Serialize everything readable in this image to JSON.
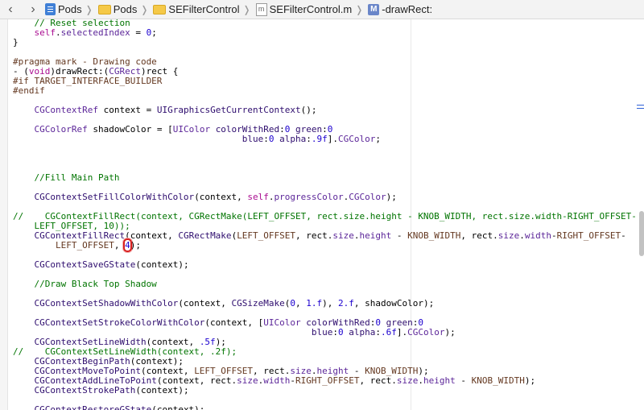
{
  "jumpbar": {
    "back_icon": "chevron-left-icon",
    "forward_icon": "chevron-right-icon",
    "crumbs": [
      "Pods",
      "Pods",
      "SEFilterControl",
      "SEFilterControl.m",
      "-drawRect:"
    ],
    "crumb_icons": [
      "project-doc-icon",
      "folder-icon",
      "folder-icon",
      "objc-file-icon",
      "method-icon"
    ],
    "file_icon_letter": "m",
    "method_icon_letter": "M"
  },
  "code_lines": [
    [
      [
        "cm",
        "    // Reset selection"
      ]
    ],
    [
      [
        "t",
        "    "
      ],
      [
        "kw",
        "self"
      ],
      [
        "t",
        "."
      ],
      [
        "ty",
        "selectedIndex"
      ],
      [
        "t",
        " = "
      ],
      [
        "nm",
        "0"
      ],
      [
        "t",
        ";"
      ]
    ],
    [
      [
        "t",
        "}"
      ]
    ],
    [
      [
        "t",
        ""
      ]
    ],
    [
      [
        "pp",
        "#pragma mark - Drawing code"
      ]
    ],
    [
      [
        "t",
        "- ("
      ],
      [
        "kw",
        "void"
      ],
      [
        "t",
        ")drawRect:("
      ],
      [
        "ty",
        "CGRect"
      ],
      [
        "t",
        ")rect {"
      ]
    ],
    [
      [
        "pp",
        "#if TARGET_INTERFACE_BUILDER"
      ]
    ],
    [
      [
        "pp",
        "#endif"
      ]
    ],
    [
      [
        "t",
        ""
      ]
    ],
    [
      [
        "t",
        "    "
      ],
      [
        "ty",
        "CGContextRef"
      ],
      [
        "t",
        " context = "
      ],
      [
        "fn",
        "UIGraphicsGetCurrentContext"
      ],
      [
        "t",
        "();"
      ]
    ],
    [
      [
        "t",
        ""
      ]
    ],
    [
      [
        "t",
        "    "
      ],
      [
        "ty",
        "CGColorRef"
      ],
      [
        "t",
        " shadowColor = ["
      ],
      [
        "ty",
        "UIColor"
      ],
      [
        "t",
        " "
      ],
      [
        "fn",
        "colorWithRed"
      ],
      [
        "t",
        ":"
      ],
      [
        "nm",
        "0"
      ],
      [
        "t",
        " "
      ],
      [
        "fn",
        "green"
      ],
      [
        "t",
        ":"
      ],
      [
        "nm",
        "0"
      ]
    ],
    [
      [
        "t",
        "                                           "
      ],
      [
        "fn",
        "blue"
      ],
      [
        "t",
        ":"
      ],
      [
        "nm",
        "0"
      ],
      [
        "t",
        " "
      ],
      [
        "fn",
        "alpha"
      ],
      [
        "t",
        ":"
      ],
      [
        "nm",
        ".9f"
      ],
      [
        "t",
        "]."
      ],
      [
        "ty",
        "CGColor"
      ],
      [
        "t",
        ";"
      ]
    ],
    [
      [
        "t",
        ""
      ]
    ],
    [
      [
        "t",
        ""
      ]
    ],
    [
      [
        "t",
        ""
      ]
    ],
    [
      [
        "cm",
        "    //Fill Main Path"
      ]
    ],
    [
      [
        "t",
        ""
      ]
    ],
    [
      [
        "t",
        "    "
      ],
      [
        "fn",
        "CGContextSetFillColorWithColor"
      ],
      [
        "t",
        "(context, "
      ],
      [
        "kw",
        "self"
      ],
      [
        "t",
        "."
      ],
      [
        "ty",
        "progressColor"
      ],
      [
        "t",
        "."
      ],
      [
        "ty",
        "CGColor"
      ],
      [
        "t",
        ");"
      ]
    ],
    [
      [
        "t",
        ""
      ]
    ],
    [
      [
        "cm",
        "//    CGContextFillRect(context, CGRectMake(LEFT_OFFSET, rect.size.height - KNOB_WIDTH, rect.size.width-RIGHT_OFFSET-"
      ]
    ],
    [
      [
        "cm",
        "    LEFT_OFFSET, 10));"
      ]
    ],
    [
      [
        "t",
        "    "
      ],
      [
        "fn",
        "CGContextFillRect"
      ],
      [
        "t",
        "(context, "
      ],
      [
        "fn",
        "CGRectMake"
      ],
      [
        "t",
        "("
      ],
      [
        "mac",
        "LEFT_OFFSET"
      ],
      [
        "t",
        ", rect."
      ],
      [
        "ty",
        "size"
      ],
      [
        "t",
        "."
      ],
      [
        "ty",
        "height"
      ],
      [
        "t",
        " - "
      ],
      [
        "mac",
        "KNOB_WIDTH"
      ],
      [
        "t",
        ", rect."
      ],
      [
        "ty",
        "size"
      ],
      [
        "t",
        "."
      ],
      [
        "ty",
        "width"
      ],
      [
        "t",
        "-"
      ],
      [
        "mac",
        "RIGHT_OFFSET"
      ],
      [
        "t",
        "-"
      ]
    ],
    [
      [
        "t",
        "        "
      ],
      [
        "mac",
        "LEFT_OFFSET"
      ],
      [
        "t",
        ", "
      ],
      [
        "hl",
        "4"
      ],
      [
        "t",
        ");"
      ]
    ],
    [
      [
        "t",
        ""
      ]
    ],
    [
      [
        "t",
        "    "
      ],
      [
        "fn",
        "CGContextSaveGState"
      ],
      [
        "t",
        "(context);"
      ]
    ],
    [
      [
        "t",
        ""
      ]
    ],
    [
      [
        "cm",
        "    //Draw Black Top Shadow"
      ]
    ],
    [
      [
        "t",
        ""
      ]
    ],
    [
      [
        "t",
        "    "
      ],
      [
        "fn",
        "CGContextSetShadowWithColor"
      ],
      [
        "t",
        "(context, "
      ],
      [
        "fn",
        "CGSizeMake"
      ],
      [
        "t",
        "("
      ],
      [
        "nm",
        "0"
      ],
      [
        "t",
        ", "
      ],
      [
        "nm",
        "1.f"
      ],
      [
        "t",
        "), "
      ],
      [
        "nm",
        "2.f"
      ],
      [
        "t",
        ", shadowColor);"
      ]
    ],
    [
      [
        "t",
        ""
      ]
    ],
    [
      [
        "t",
        "    "
      ],
      [
        "fn",
        "CGContextSetStrokeColorWithColor"
      ],
      [
        "t",
        "(context, ["
      ],
      [
        "ty",
        "UIColor"
      ],
      [
        "t",
        " "
      ],
      [
        "fn",
        "colorWithRed"
      ],
      [
        "t",
        ":"
      ],
      [
        "nm",
        "0"
      ],
      [
        "t",
        " "
      ],
      [
        "fn",
        "green"
      ],
      [
        "t",
        ":"
      ],
      [
        "nm",
        "0"
      ]
    ],
    [
      [
        "t",
        "                                                        "
      ],
      [
        "fn",
        "blue"
      ],
      [
        "t",
        ":"
      ],
      [
        "nm",
        "0"
      ],
      [
        "t",
        " "
      ],
      [
        "fn",
        "alpha"
      ],
      [
        "t",
        ":"
      ],
      [
        "nm",
        ".6f"
      ],
      [
        "t",
        "]."
      ],
      [
        "ty",
        "CGColor"
      ],
      [
        "t",
        ");"
      ]
    ],
    [
      [
        "t",
        "    "
      ],
      [
        "fn",
        "CGContextSetLineWidth"
      ],
      [
        "t",
        "(context, "
      ],
      [
        "nm",
        ".5f"
      ],
      [
        "t",
        ");"
      ]
    ],
    [
      [
        "cm",
        "//    CGContextSetLineWidth(context, .2f);"
      ]
    ],
    [
      [
        "t",
        "    "
      ],
      [
        "fn",
        "CGContextBeginPath"
      ],
      [
        "t",
        "(context);"
      ]
    ],
    [
      [
        "t",
        "    "
      ],
      [
        "fn",
        "CGContextMoveToPoint"
      ],
      [
        "t",
        "(context, "
      ],
      [
        "mac",
        "LEFT_OFFSET"
      ],
      [
        "t",
        ", rect."
      ],
      [
        "ty",
        "size"
      ],
      [
        "t",
        "."
      ],
      [
        "ty",
        "height"
      ],
      [
        "t",
        " - "
      ],
      [
        "mac",
        "KNOB_WIDTH"
      ],
      [
        "t",
        ");"
      ]
    ],
    [
      [
        "t",
        "    "
      ],
      [
        "fn",
        "CGContextAddLineToPoint"
      ],
      [
        "t",
        "(context, rect."
      ],
      [
        "ty",
        "size"
      ],
      [
        "t",
        "."
      ],
      [
        "ty",
        "width"
      ],
      [
        "t",
        "-"
      ],
      [
        "mac",
        "RIGHT_OFFSET"
      ],
      [
        "t",
        ", rect."
      ],
      [
        "ty",
        "size"
      ],
      [
        "t",
        "."
      ],
      [
        "ty",
        "height"
      ],
      [
        "t",
        " - "
      ],
      [
        "mac",
        "KNOB_WIDTH"
      ],
      [
        "t",
        ");"
      ]
    ],
    [
      [
        "t",
        "    "
      ],
      [
        "fn",
        "CGContextStrokePath"
      ],
      [
        "t",
        "(context);"
      ]
    ],
    [
      [
        "t",
        ""
      ]
    ],
    [
      [
        "t",
        "    "
      ],
      [
        "fn",
        "CGContextRestoreGState"
      ],
      [
        "t",
        "(context);"
      ]
    ]
  ],
  "colors": {
    "keyword": "#aa0d91",
    "type": "#5c2699",
    "function": "#2e0d6e",
    "preprocessor": "#643820",
    "comment": "#007400",
    "number": "#1c00cf",
    "highlight_ring": "#d81f1f"
  }
}
